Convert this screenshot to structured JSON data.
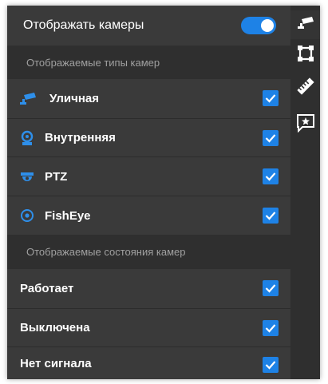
{
  "header": {
    "show_cameras_label": "Отображать камеры",
    "toggle_on": true
  },
  "types_section": {
    "title": "Отображаемые типы камер",
    "items": [
      {
        "label": "Уличная",
        "icon": "outdoor-camera-icon",
        "checked": true
      },
      {
        "label": "Внутренняя",
        "icon": "indoor-camera-icon",
        "checked": true
      },
      {
        "label": "PTZ",
        "icon": "ptz-camera-icon",
        "checked": true
      },
      {
        "label": "FishEye",
        "icon": "fisheye-camera-icon",
        "checked": true
      }
    ]
  },
  "states_section": {
    "title": "Отображаемые состояния камер",
    "items": [
      {
        "label": "Работает",
        "checked": true
      },
      {
        "label": "Выключена",
        "checked": true
      },
      {
        "label": "Нет сигнала",
        "checked": true
      }
    ]
  },
  "sidebar": {
    "buttons": [
      {
        "icon": "camera-icon",
        "active": true
      },
      {
        "icon": "polygon-select-icon",
        "active": false
      },
      {
        "icon": "ruler-icon",
        "active": false
      },
      {
        "icon": "star-comment-icon",
        "active": false
      }
    ]
  },
  "colors": {
    "accent": "#1e82e6",
    "panel_bg": "#3a3a3a",
    "section_bg": "#2f2f2f",
    "text": "#ffffff",
    "section_text": "#a0a0a0"
  }
}
